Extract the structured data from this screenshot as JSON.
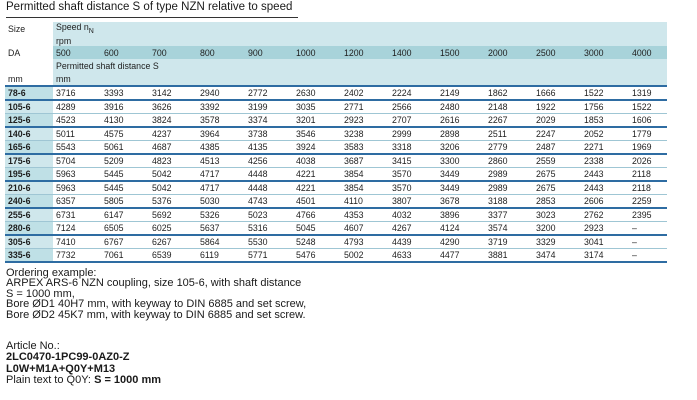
{
  "title": "Permitted shaft distance S of type NZN relative to speed",
  "header": {
    "size_label": "Size",
    "speed_label": "Speed n",
    "speed_sub": "N",
    "rpm": "rpm",
    "da": "DA",
    "speeds": [
      "500",
      "600",
      "700",
      "800",
      "900",
      "1000",
      "1200",
      "1400",
      "1500",
      "2000",
      "2500",
      "3000",
      "4000"
    ],
    "permitted": "Permitted shaft distance S",
    "mm": "mm",
    "mm_left": "mm"
  },
  "rows": [
    {
      "size": "78-6",
      "values": [
        "3716",
        "3393",
        "3142",
        "2940",
        "2772",
        "2630",
        "2402",
        "2224",
        "2149",
        "1862",
        "1666",
        "1522",
        "1319"
      ]
    },
    {
      "size": "105-6",
      "values": [
        "4289",
        "3916",
        "3626",
        "3392",
        "3199",
        "3035",
        "2771",
        "2566",
        "2480",
        "2148",
        "1922",
        "1756",
        "1522"
      ]
    },
    {
      "size": "125-6",
      "values": [
        "4523",
        "4130",
        "3824",
        "3578",
        "3374",
        "3201",
        "2923",
        "2707",
        "2616",
        "2267",
        "2029",
        "1853",
        "1606"
      ]
    },
    {
      "size": "140-6",
      "values": [
        "5011",
        "4575",
        "4237",
        "3964",
        "3738",
        "3546",
        "3238",
        "2999",
        "2898",
        "2511",
        "2247",
        "2052",
        "1779"
      ]
    },
    {
      "size": "165-6",
      "values": [
        "5543",
        "5061",
        "4687",
        "4385",
        "4135",
        "3924",
        "3583",
        "3318",
        "3206",
        "2779",
        "2487",
        "2271",
        "1969"
      ]
    },
    {
      "size": "175-6",
      "values": [
        "5704",
        "5209",
        "4823",
        "4513",
        "4256",
        "4038",
        "3687",
        "3415",
        "3300",
        "2860",
        "2559",
        "2338",
        "2026"
      ]
    },
    {
      "size": "195-6",
      "values": [
        "5963",
        "5445",
        "5042",
        "4717",
        "4448",
        "4221",
        "3854",
        "3570",
        "3449",
        "2989",
        "2675",
        "2443",
        "2118"
      ]
    },
    {
      "size": "210-6",
      "values": [
        "5963",
        "5445",
        "5042",
        "4717",
        "4448",
        "4221",
        "3854",
        "3570",
        "3449",
        "2989",
        "2675",
        "2443",
        "2118"
      ]
    },
    {
      "size": "240-6",
      "values": [
        "6357",
        "5805",
        "5376",
        "5030",
        "4743",
        "4501",
        "4110",
        "3807",
        "3678",
        "3188",
        "2853",
        "2606",
        "2259"
      ]
    },
    {
      "size": "255-6",
      "values": [
        "6731",
        "6147",
        "5692",
        "5326",
        "5023",
        "4766",
        "4353",
        "4032",
        "3896",
        "3377",
        "3023",
        "2762",
        "2395"
      ]
    },
    {
      "size": "280-6",
      "values": [
        "7124",
        "6505",
        "6025",
        "5637",
        "5316",
        "5045",
        "4607",
        "4267",
        "4124",
        "3574",
        "3200",
        "2923",
        "–"
      ]
    },
    {
      "size": "305-6",
      "values": [
        "7410",
        "6767",
        "6267",
        "5864",
        "5530",
        "5248",
        "4793",
        "4439",
        "4290",
        "3719",
        "3329",
        "3041",
        "–"
      ]
    },
    {
      "size": "335-6",
      "values": [
        "7732",
        "7061",
        "6539",
        "6119",
        "5771",
        "5476",
        "5002",
        "4633",
        "4477",
        "3881",
        "3474",
        "3174",
        "–"
      ]
    }
  ],
  "ordering": {
    "heading": "Ordering example:",
    "lines": [
      "ARPEX ARS-6 NZN coupling, size 105-6, with shaft distance",
      "S = 1000 mm,",
      "Bore ØD1 40H7 mm, with keyway to DIN 6885 and set screw,",
      "Bore ØD2 45K7 mm, with keyway to DIN 6885 and set screw."
    ]
  },
  "article": {
    "heading": "Article No.:",
    "number": "2LC0470-1PC99-0AZ0-Z",
    "options": "L0W+M1A+Q0Y+M13",
    "plain_prefix": "Plain text to Q0Y: ",
    "plain_value": "S = 1000 mm"
  },
  "colors": {
    "header_light": "#cfe7ec",
    "header_dark": "#a8d3da",
    "rule_blue": "#2e6ca2"
  }
}
